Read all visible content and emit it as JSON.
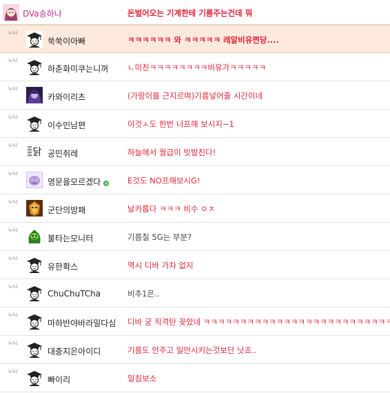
{
  "original": {
    "nick": "DVa송하나",
    "message": "돈벌어오는 기계한테 기름주는건데 뭐"
  },
  "reply_label": "RE",
  "replies": [
    {
      "nick": "쑥쑥이아빠",
      "message": "ㅋㅋㅋㅋㅋㅋ 와 ㅋㅋㅋㅋㅋ 레알비유쩐당....",
      "msg_color": "red",
      "highlight": true,
      "avatar": "graduate-avatar"
    },
    {
      "nick": "하춘화미쿠는니꺼",
      "message": "ㄴ미친ㅋㅋㅋㅋㅋㅋㅋㅋ비유가ㅋㅋㅋㅋㅋ",
      "msg_color": "red",
      "avatar": "graduate-avatar"
    },
    {
      "nick": "카와이리츠",
      "message": "(가랑이를 근지르며)기름넣어줄 시간이네",
      "msg_color": "red",
      "avatar": "purple-character-avatar"
    },
    {
      "nick": "이수민남편",
      "message": "이것ㅅ도 한번 너프해 보시지~1",
      "msg_color": "red",
      "avatar": "graduate-avatar"
    },
    {
      "nick": "공민쥐레",
      "message": "하늘에서 월급이 빗발친다!",
      "msg_color": "red",
      "avatar": "text-avatar",
      "avatar_text": "닭"
    },
    {
      "nick": "영문을모르겠다",
      "message": "E것도 NO프해보시G!",
      "msg_color": "red",
      "avatar": "purple-creature-avatar",
      "online": true
    },
    {
      "nick": "군단의방패",
      "message": "날카롭다 ㅋㅋㅋ 비수 ㅇㅈ",
      "msg_color": "red",
      "avatar": "golden-mask-avatar"
    },
    {
      "nick": "불타는모니터",
      "message": "기름칠 5G는 부분?",
      "msg_color": "dark",
      "avatar": "green-monster-avatar"
    },
    {
      "nick": "유한확스",
      "message": "역시 디바 가차 없지",
      "msg_color": "red",
      "avatar": "graduate-avatar"
    },
    {
      "nick": "ChuChuTCha",
      "message": "비추1은..",
      "msg_color": "dark",
      "avatar": "graduate-avatar"
    },
    {
      "nick": "마하반야바라밀다심",
      "message": "디바 궁 직격탄 꽂았네 ㅋㅋㅋㅋㅋㅋㅋㅋㅋㅋㅋㅋㅋㅋㅋㅋㅋㅋㅋㅋㅋㅋㅋㅋㅋㅋㅋ",
      "msg_color": "red",
      "avatar": "graduate-avatar"
    },
    {
      "nick": "대충지은아이디",
      "message": "기름도 안주고 일만시키는것보단 낫죠..",
      "msg_color": "red",
      "avatar": "graduate-avatar"
    },
    {
      "nick": "빠이리",
      "message": "일침보소",
      "msg_color": "red",
      "avatar": "graduate-avatar"
    }
  ],
  "colors": {
    "red": "#e0253a",
    "dark": "#444444",
    "highlight_bg": "#fdeadd",
    "nick_original": "#c0307f"
  }
}
